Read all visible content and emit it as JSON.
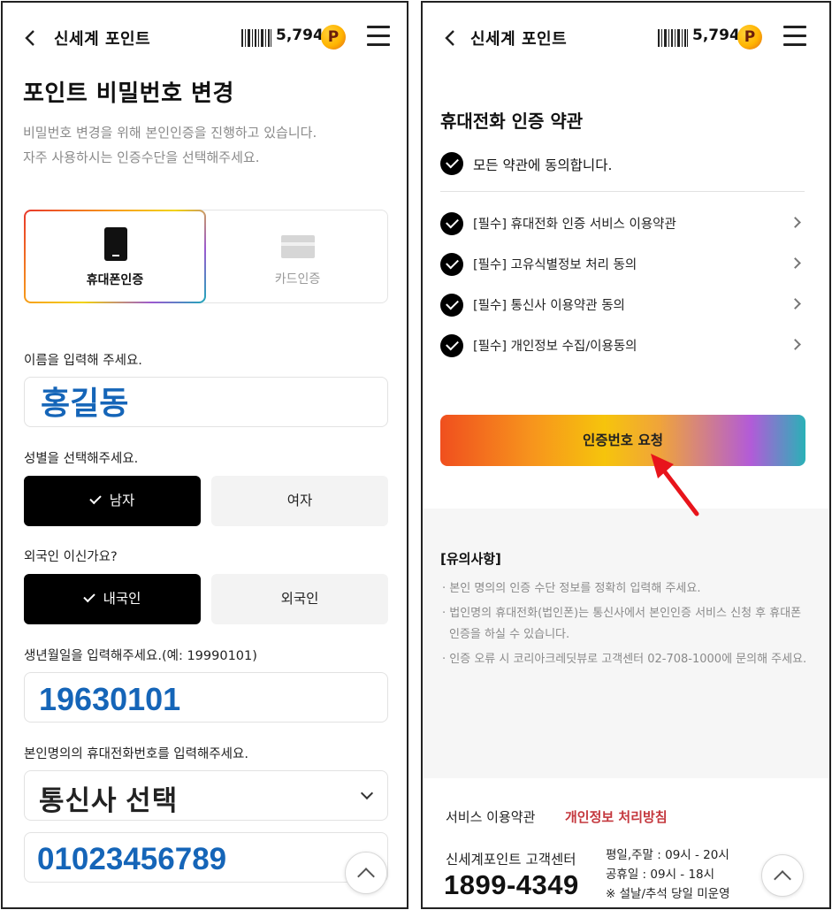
{
  "header": {
    "title": "신세계 포인트",
    "points": "5,794",
    "point_badge": "P"
  },
  "left": {
    "page_title": "포인트 비밀번호 변경",
    "desc_line1": "비밀번호 변경을 위해 본인인증을 진행하고 있습니다.",
    "desc_line2": "자주 사용하시는 인증수단을 선택해주세요.",
    "auth_options": [
      {
        "label": "휴대폰인증",
        "selected": true
      },
      {
        "label": "카드인증",
        "selected": false
      }
    ],
    "name_label": "이름을 입력해 주세요.",
    "name_value": "홍길동",
    "gender_label": "성별을 선택해주세요.",
    "gender_male": "남자",
    "gender_female": "여자",
    "foreigner_label": "외국인 이신가요?",
    "domestic": "내국인",
    "foreign": "외국인",
    "birth_label": "생년월일을 입력해주세요.(예: 19990101)",
    "birth_value": "19630101",
    "phone_label": "본인명의의 휴대전화번호를 입력해주세요.",
    "carrier_select": "통신사 선택",
    "phone_value": "01023456789"
  },
  "right": {
    "section_title": "휴대전화 인증 약관",
    "agree_all": "모든 약관에 동의합니다.",
    "terms": [
      "[필수] 휴대전화 인증 서비스 이용약관",
      "[필수] 고유식별정보 처리 동의",
      "[필수] 통신사 이용약관 동의",
      "[필수] 개인정보 수집/이용동의"
    ],
    "request_button": "인증번호 요청",
    "notice_title": "[유의사항]",
    "notices": [
      "· 본인 명의의 인증 수단 정보를 정확히 입력해 주세요.",
      "· 법인명의 휴대전화(법인폰)는 통신사에서 본인인증 서비스 신청 후 휴대폰 인증을 하실 수 있습니다.",
      "· 인증 오류 시 코리아크레딧뷰로 고객센터 02-708-1000에 문의해 주세요."
    ],
    "footer": {
      "terms_link": "서비스 이용약관",
      "privacy_link": "개인정보 처리방침",
      "cs_label": "신세계포인트 고객센터",
      "cs_phone": "1899-4349",
      "hours_line1": "평일,주말 : 09시 - 20시",
      "hours_line2": "공휴일 : 09시 - 18시",
      "hours_line3": "※ 설날/추석 당일 미운영"
    }
  },
  "colors": {
    "accent_red": "#c4373d",
    "input_blue": "#1565b8",
    "annotation_arrow": "#e8141b"
  }
}
